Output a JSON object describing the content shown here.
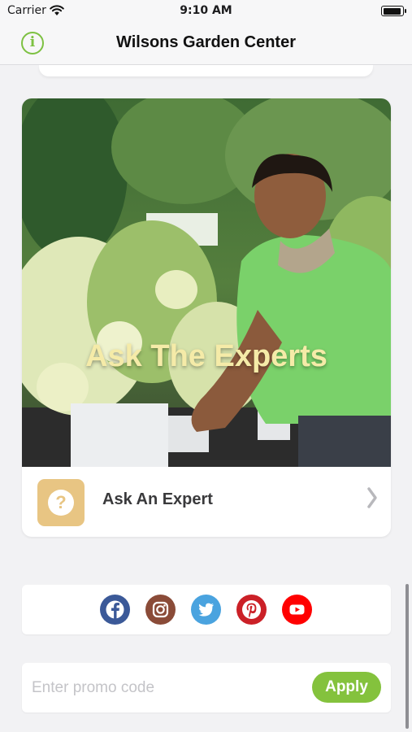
{
  "status_bar": {
    "carrier": "Carrier",
    "time": "9:10 AM"
  },
  "nav": {
    "title": "Wilsons Garden Center",
    "info_icon": "info-circle-icon",
    "accent_color": "#7dc142"
  },
  "feature_card": {
    "image_heading": "Ask The Experts",
    "item_label": "Ask An Expert",
    "item_icon": "question-circle-icon",
    "item_icon_color": "#e8c583"
  },
  "social": [
    {
      "name": "facebook",
      "icon": "facebook-icon",
      "color": "#3b5998"
    },
    {
      "name": "instagram",
      "icon": "instagram-icon",
      "color": "#8a4b38"
    },
    {
      "name": "twitter",
      "icon": "twitter-icon",
      "color": "#4aa3df"
    },
    {
      "name": "pinterest",
      "icon": "pinterest-icon",
      "color": "#cb2027"
    },
    {
      "name": "youtube",
      "icon": "youtube-icon",
      "color": "#ff0000"
    }
  ],
  "promo": {
    "placeholder": "Enter promo code",
    "value": "",
    "apply_label": "Apply",
    "apply_color": "#84c23d"
  }
}
